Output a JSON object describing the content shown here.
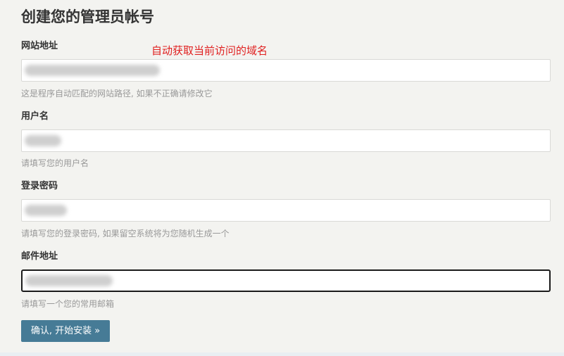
{
  "page": {
    "title": "创建您的管理员帐号",
    "annotation": "自动获取当前访问的域名"
  },
  "fields": {
    "site_url": {
      "label": "网站地址",
      "value": "",
      "hint": "这是程序自动匹配的网站路径, 如果不正确请修改它"
    },
    "username": {
      "label": "用户名",
      "value": "",
      "hint": "请填写您的用户名"
    },
    "password": {
      "label": "登录密码",
      "value": "",
      "hint": "请填写您的登录密码, 如果留空系统将为您随机生成一个"
    },
    "email": {
      "label": "邮件地址",
      "value": "",
      "hint": "请填写一个您的常用邮箱"
    }
  },
  "actions": {
    "submit_label": "确认, 开始安装 »"
  },
  "colors": {
    "button_bg": "#467b96",
    "annotation": "#e02020",
    "hint_text": "#999999"
  }
}
